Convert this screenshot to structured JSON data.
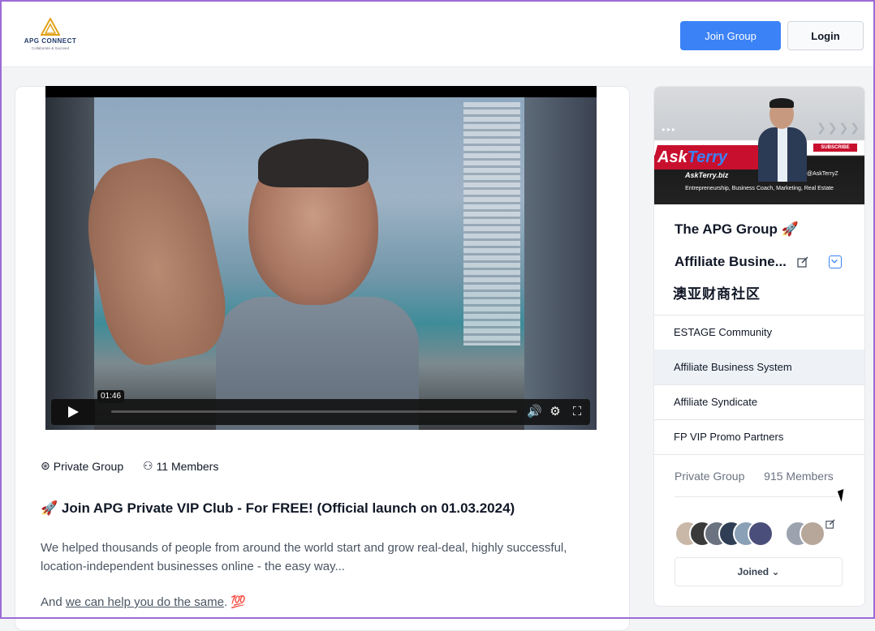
{
  "header": {
    "logo_name": "APG CONNECT",
    "logo_tagline": "Collaborate & Succeed",
    "join_label": "Join Group",
    "login_label": "Login",
    "accent_color": "#3b82f6"
  },
  "video": {
    "timestamp": "01:46",
    "icons": [
      "play-icon",
      "volume-icon",
      "settings-icon",
      "fullscreen-icon"
    ]
  },
  "post": {
    "privacy_label": "Private Group",
    "members_label": "11 Members",
    "title": "🚀 Join APG Private VIP Club - For FREE! (Official launch on 01.03.2024)",
    "body": "We helped thousands of people from around the world start and grow real-deal, highly successful, location-independent businesses online - the easy way...",
    "body2_prefix": "And ",
    "body2_link": "we can help you do the same",
    "body2_suffix": ". 💯"
  },
  "sidebar": {
    "banner": {
      "brand_left": "Ask",
      "brand_right": "Terry",
      "site": "AskTerry.biz",
      "subscribe": "SUBSCRIBE",
      "handle": "@AskTerryZ",
      "tagline": "Entrepreneurship, Business Coach, Marketing, Real Estate"
    },
    "group_name_line1": "The APG Group 🚀",
    "group_name_line2": "Affiliate Busine...",
    "group_chinese": "澳亚财商社区",
    "items": [
      {
        "label": "ESTAGE Community",
        "active": false
      },
      {
        "label": "Affiliate Business System",
        "active": true
      },
      {
        "label": "Affiliate Syndicate",
        "active": false
      },
      {
        "label": "FP VIP Promo Partners",
        "active": false
      }
    ],
    "privacy": "Private Group",
    "members": "915 Members",
    "joined_label": "Joined ⌄"
  }
}
